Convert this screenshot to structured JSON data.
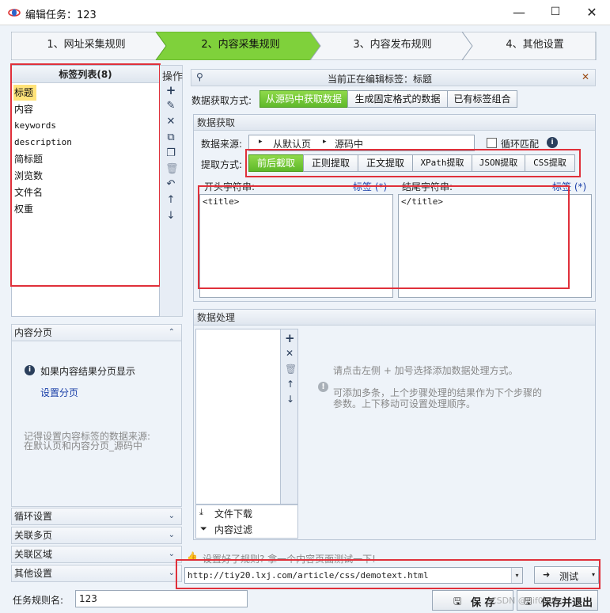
{
  "window": {
    "title": "编辑任务：123",
    "controls": [
      "—",
      "☐",
      "✕"
    ]
  },
  "steps": [
    {
      "label": "1、网址采集规则",
      "active": false
    },
    {
      "label": "2、内容采集规则",
      "active": true
    },
    {
      "label": "3、内容发布规则",
      "active": false
    },
    {
      "label": "4、其他设置",
      "active": false
    }
  ],
  "tag_list": {
    "title": "标签列表(8)",
    "items": [
      "标题",
      "内容",
      "keywords",
      "description",
      "简标题",
      "浏览数",
      "文件名",
      "权重"
    ],
    "selected": 0
  },
  "ops": {
    "title": "操作"
  },
  "left_sections": {
    "pagination_title": "内容分页",
    "pagination_info": "如果内容结果分页显示",
    "pagination_link": "设置分页",
    "pagination_note_1": "记得设置内容标签的数据来源:",
    "pagination_note_2": "在默认页和内容分页_源码中",
    "loop": "循环设置",
    "multi_page": "关联多页",
    "region": "关联区域",
    "other": "其他设置"
  },
  "editing": {
    "label": "当前正在编辑标签：标题"
  },
  "fetch_mode": {
    "label": "数据获取方式:",
    "options": [
      "从源码中获取数据",
      "生成固定格式的数据",
      "已有标签组合"
    ],
    "selected": 0
  },
  "data_fetch": {
    "title": "数据获取",
    "source_label": "数据来源:",
    "source_path": [
      "从默认页",
      "源码中"
    ],
    "loop_match": "循环匹配",
    "extract_label": "提取方式:",
    "extract_options": [
      "前后截取",
      "正则提取",
      "正文提取",
      "XPath提取",
      "JSON提取",
      "CSS提取"
    ],
    "extract_selected": 0,
    "start_label": "开头字符串:",
    "end_label": "结尾字符串:",
    "tag_link": "标签 (*)",
    "start_value": "<title>",
    "end_value": "</title>"
  },
  "processing": {
    "title": "数据处理",
    "tools": [
      "文件下载",
      "内容过滤"
    ],
    "hint_1": "请点击左侧 + 加号选择添加数据处理方式。",
    "hint_2": "可添加多条，上个步骤处理的结果作为下个步骤的",
    "hint_3": "参数。上下移动可设置处理顺序。"
  },
  "test": {
    "hint": "设置好了规则? 拿一个内容页面测试一下!",
    "url": "http://tiy20.lxj.com/article/css/demotext.html",
    "button": "测试"
  },
  "footer": {
    "name_label": "任务规则名:",
    "name_value": "123",
    "save": "保 存",
    "save_exit": "保存并退出",
    "watermark": "CSDN @dif03lfl"
  },
  "colors": {
    "active_green": "#6cc333",
    "highlight_red": "#e0303a",
    "selected_yellow": "#ffe37a",
    "link_blue": "#1a3fa8"
  }
}
